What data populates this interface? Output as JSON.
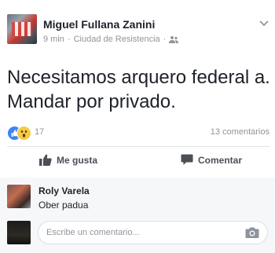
{
  "post": {
    "author": "Miguel Fullana Zanini",
    "time": "9 min",
    "separator": "·",
    "location": "Ciudad de Resistencia",
    "privacy_icon": "friends-icon",
    "text_line1": "Necesitamos arquero federal a.",
    "text_line2": "Mandar por privado."
  },
  "reactions": {
    "icons": [
      "like-reaction-icon",
      "wow-reaction-icon"
    ],
    "count": "17",
    "comments": "13 comentarios"
  },
  "actions": {
    "like_label": "Me gusta",
    "comment_label": "Comentar"
  },
  "comments": [
    {
      "author": "Roly Varela",
      "text": "Ober padua"
    }
  ],
  "composer": {
    "placeholder": "Escribe un comentario..."
  },
  "colors": {
    "like_blue": "#3b83f7",
    "wow_yellow": "#f7c945",
    "muted_text": "#90949c",
    "comment_bg": "#f6f7f9"
  }
}
